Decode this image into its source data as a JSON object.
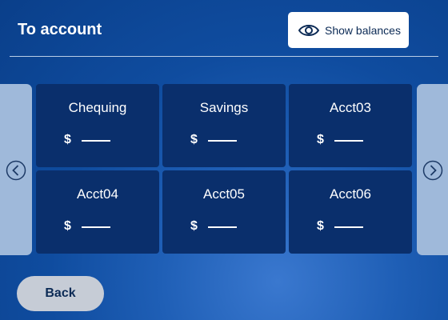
{
  "header": {
    "title": "To account",
    "show_balances_label": "Show balances",
    "show_balances_icon": "eye-icon"
  },
  "accounts": [
    {
      "name": "Chequing",
      "currency": "$",
      "balance": "——"
    },
    {
      "name": "Savings",
      "currency": "$",
      "balance": "——"
    },
    {
      "name": "Acct03",
      "currency": "$",
      "balance": "——"
    },
    {
      "name": "Acct04",
      "currency": "$",
      "balance": "——"
    },
    {
      "name": "Acct05",
      "currency": "$",
      "balance": "——"
    },
    {
      "name": "Acct06",
      "currency": "$",
      "balance": "——"
    }
  ],
  "navigation": {
    "prev_icon": "chevron-left-circle-icon",
    "next_icon": "chevron-right-circle-icon"
  },
  "footer": {
    "back_label": "Back"
  },
  "colors": {
    "background": "#0f4c9f",
    "tile": "#0a2f6c",
    "side_arrow": "#9fb9da",
    "back_button": "#c6ccd6"
  }
}
